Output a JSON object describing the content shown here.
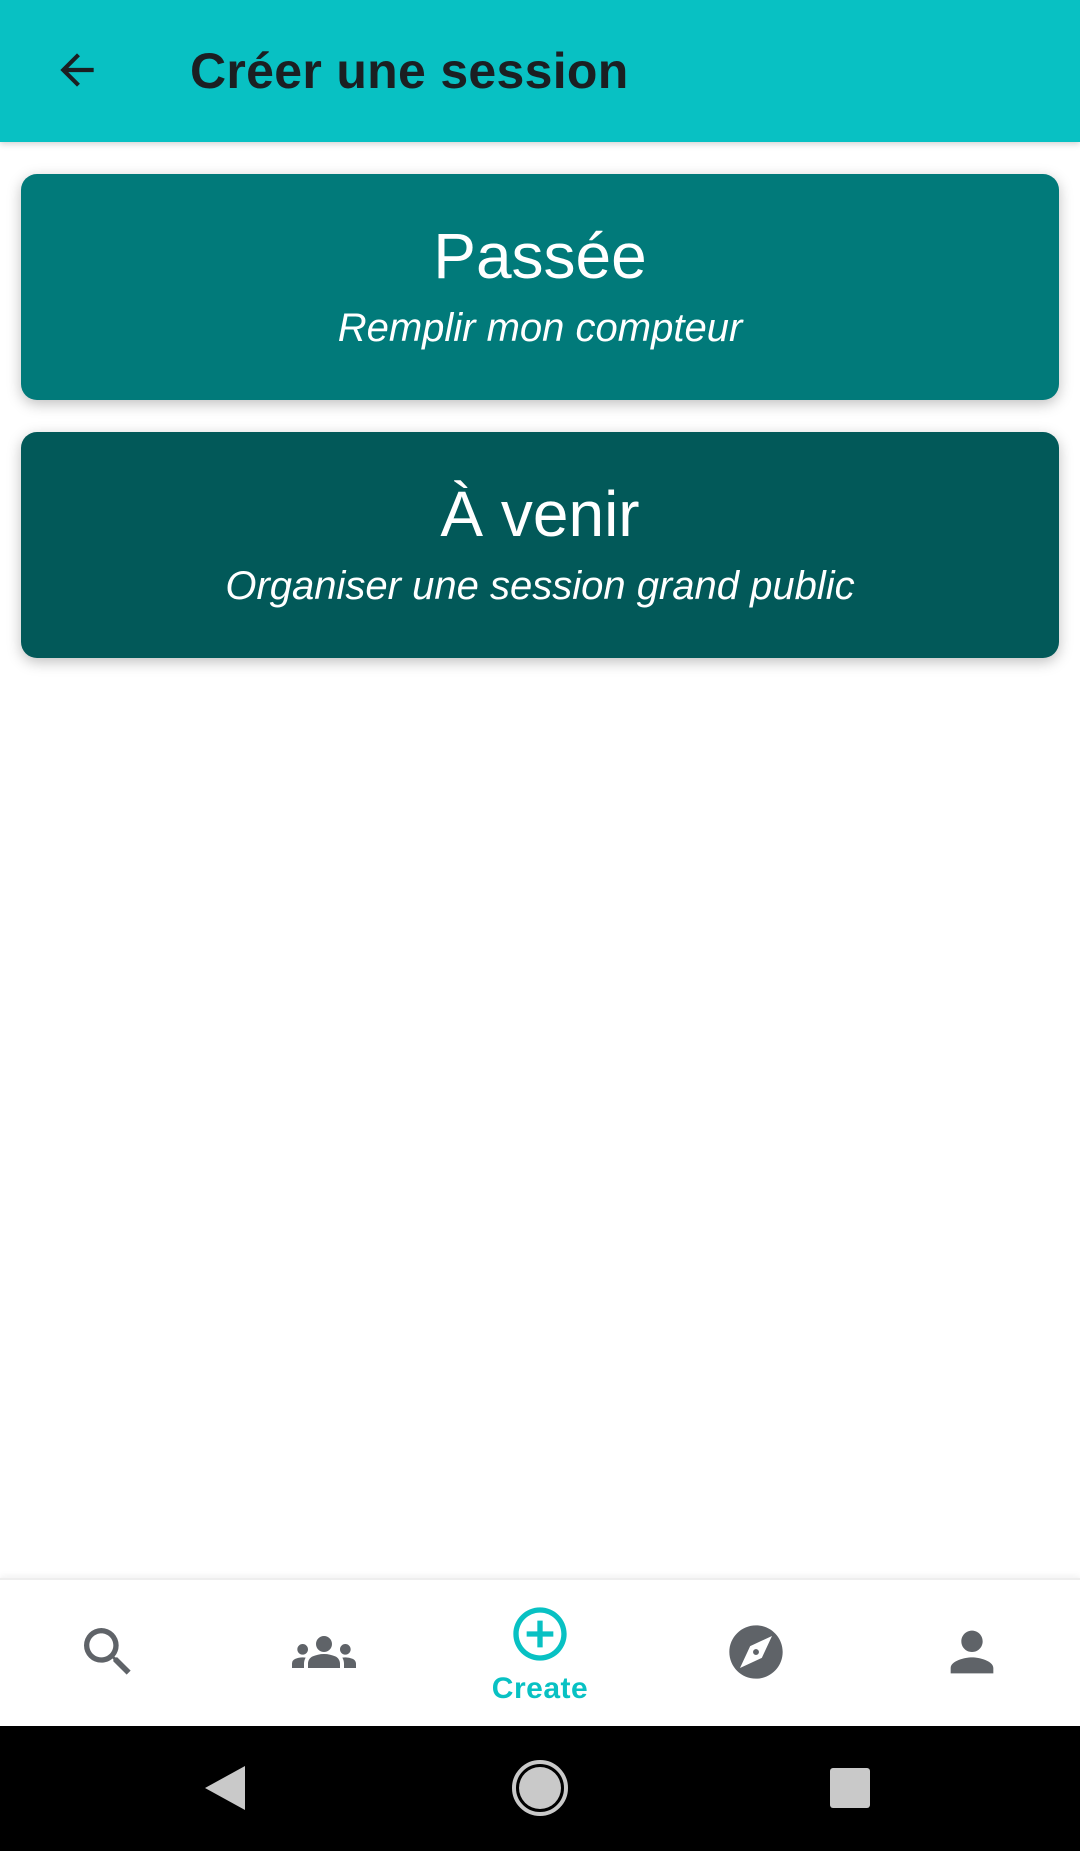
{
  "header": {
    "title": "Créer une session",
    "back_icon": "arrow-back-icon"
  },
  "cards": [
    {
      "title": "Passée",
      "subtitle": "Remplir mon compteur",
      "color": "#017a7a"
    },
    {
      "title": "À venir",
      "subtitle": "Organiser une session grand public",
      "color": "#025959"
    }
  ],
  "bottom_nav": {
    "items": [
      {
        "icon": "search-icon",
        "label": "",
        "active": false
      },
      {
        "icon": "group-icon",
        "label": "",
        "active": false
      },
      {
        "icon": "add-circle-icon",
        "label": "Create",
        "active": true
      },
      {
        "icon": "compass-icon",
        "label": "",
        "active": false
      },
      {
        "icon": "person-icon",
        "label": "",
        "active": false
      }
    ]
  },
  "system_nav": {
    "items": [
      "back-triangle-icon",
      "home-circle-icon",
      "recents-square-icon"
    ]
  },
  "colors": {
    "accent": "#08c1c3",
    "inactive_icon": "#5f6368",
    "header_text": "#1b1f22"
  }
}
